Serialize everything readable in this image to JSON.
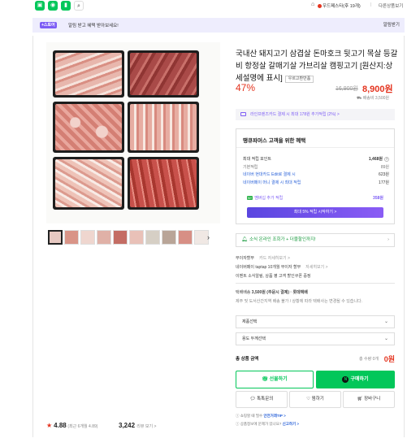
{
  "topbar": {
    "user_label": "우드페스타(후 19개)",
    "more_label": "다른상품보기"
  },
  "banner": {
    "badge": "스토어",
    "text": "알림 받고 혜택 받아보세요!",
    "button": "알림받기"
  },
  "product": {
    "title": "국내산 돼지고기 삼겹살 돈마호크 뒷고기 목살 등갈비 항정살 갈매기살 가브리살 캠핑고기 [원산지:상세설명에 표시]",
    "origin_tag": "우르고환반품",
    "discount": "47%",
    "original_price": "16,900원",
    "price": "8,900원",
    "shipping": "배송비 3,500원"
  },
  "card_promo": "라인프렌즈카드 결제 시 최대 178원 추가적립 (2%) >",
  "benefit": {
    "heading": "땡큐파머스 고객을 위한 혜택",
    "rows": [
      {
        "label": "최대 적립 포인트",
        "value": "1,468원"
      },
      {
        "label": "기본적립",
        "value": "89원"
      },
      {
        "label": "네이버 현대카드 Edit로 결제 시",
        "value": "623원"
      },
      {
        "label": "네이버페이 머니 결제 시 최대 적립",
        "value": "177원"
      }
    ],
    "membership_label": "멤버십 추가 적립",
    "membership_value": "358원",
    "membership_button": "최대 5% 적립 시작하기 >"
  },
  "notify": "소식 온라인 조회가 + 더블할인까지!",
  "info": {
    "installment": "무이자할부",
    "installment_link": "카드 자세히보기 >",
    "taptap": "네이버페이 taptap 10개월 무이자 할부",
    "taptap_link": "자세히보기 >",
    "event": "이벤트 소식알림, 상품 평 고객 할인쿠폰 증정",
    "shipping_label": "택배배송",
    "shipping_value": "3,500원 (주문시 결제) · 롯데택배",
    "shipping_note": "제주 및 도서산간지역 배송 불가 / 상황에 따라 택배사는 변경될 수 있습니다."
  },
  "selects": [
    "제품선택",
    "용도 두께선택"
  ],
  "total": {
    "label": "총 상품 금액",
    "qty": "총 수량 0개",
    "amount": "0원"
  },
  "buttons": {
    "gift": "선물하기",
    "buy": "구매하기",
    "talk": "톡톡문의",
    "wish": "찜하기",
    "cart": "장바구니"
  },
  "footer": {
    "line1_prefix": "쇼핑할 때 필수",
    "line1_link": "안전거래TIP >",
    "line2_prefix": "상품정보에 문제가 있나요?",
    "line2_link": "신고하기 >"
  },
  "rating": {
    "score": "4.88",
    "sub": "(최근 6개월 4.89)",
    "reviews": "3,242",
    "reviews_label": "리뷰 보기 >"
  }
}
